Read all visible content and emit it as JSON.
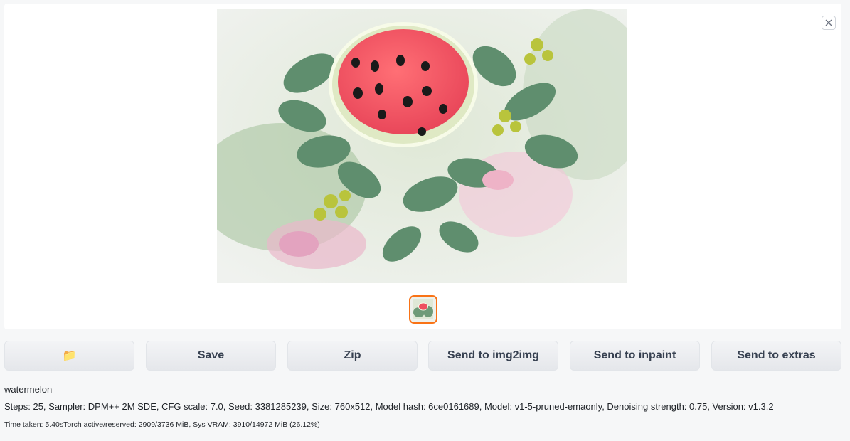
{
  "gallery": {
    "close_label": "×",
    "main_image": "watermelon-bouquet-image",
    "thumbnail": "watermelon-bouquet-thumbnail"
  },
  "buttons": {
    "folder_icon": "📁",
    "save": "Save",
    "zip": "Zip",
    "send_img2img": "Send to img2img",
    "send_inpaint": "Send to inpaint",
    "send_extras": "Send to extras"
  },
  "info": {
    "prompt": "watermelon",
    "params": "Steps: 25, Sampler: DPM++ 2M SDE, CFG scale: 7.0, Seed: 3381285239, Size: 760x512, Model hash: 6ce0161689, Model: v1-5-pruned-emaonly, Denoising strength: 0.75, Version: v1.3.2",
    "timing": "Time taken: 5.40sTorch active/reserved: 2909/3736 MiB, Sys VRAM: 3910/14972 MiB (26.12%)"
  },
  "colors": {
    "selected_thumb_border": "#f97316",
    "button_bg": "#e5e7eb",
    "panel_bg": "#ffffff"
  }
}
